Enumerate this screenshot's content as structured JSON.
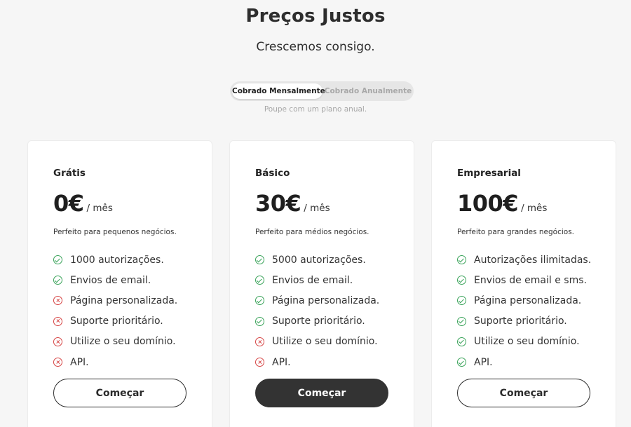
{
  "header": {
    "title": "Preços Justos",
    "subtitle": "Crescemos consigo."
  },
  "billing_toggle": {
    "monthly_label": "Cobrado Mensalmente",
    "annual_label": "Cobrado Anualmente",
    "selected": "monthly",
    "hint": "Poupe com um plano anual."
  },
  "colors": {
    "check": "#3aa35a",
    "cross": "#d64545",
    "primary_button": "#333333"
  },
  "plans": [
    {
      "name": "Grátis",
      "price": "0€",
      "period": "/ mês",
      "description": "Perfeito para pequenos negócios.",
      "features": [
        {
          "label": "1000 autorizações.",
          "icon": "check-icon"
        },
        {
          "label": "Envios de email.",
          "icon": "check-icon"
        },
        {
          "label": "Página personalizada.",
          "icon": "cross-icon"
        },
        {
          "label": "Suporte prioritário.",
          "icon": "cross-icon"
        },
        {
          "label": "Utilize o seu domínio.",
          "icon": "cross-icon"
        },
        {
          "label": "API.",
          "icon": "cross-icon"
        }
      ],
      "cta": "Começar"
    },
    {
      "name": "Básico",
      "price": "30€",
      "period": "/ mês",
      "description": "Perfeito para médios negócios.",
      "features": [
        {
          "label": "5000 autorizações.",
          "icon": "check-icon"
        },
        {
          "label": "Envios de email.",
          "icon": "check-icon"
        },
        {
          "label": "Página personalizada.",
          "icon": "check-icon"
        },
        {
          "label": "Suporte prioritário.",
          "icon": "check-icon"
        },
        {
          "label": "Utilize o seu domínio.",
          "icon": "cross-icon"
        },
        {
          "label": "API.",
          "icon": "cross-icon"
        }
      ],
      "cta": "Começar"
    },
    {
      "name": "Empresarial",
      "price": "100€",
      "period": "/ mês",
      "description": "Perfeito para grandes negócios.",
      "features": [
        {
          "label": "Autorizações ilimitadas.",
          "icon": "check-icon"
        },
        {
          "label": "Envios de email e sms.",
          "icon": "check-icon"
        },
        {
          "label": "Página personalizada.",
          "icon": "check-icon"
        },
        {
          "label": "Suporte prioritário.",
          "icon": "check-icon"
        },
        {
          "label": "Utilize o seu domínio.",
          "icon": "check-icon"
        },
        {
          "label": "API.",
          "icon": "check-icon"
        }
      ],
      "cta": "Começar"
    }
  ]
}
